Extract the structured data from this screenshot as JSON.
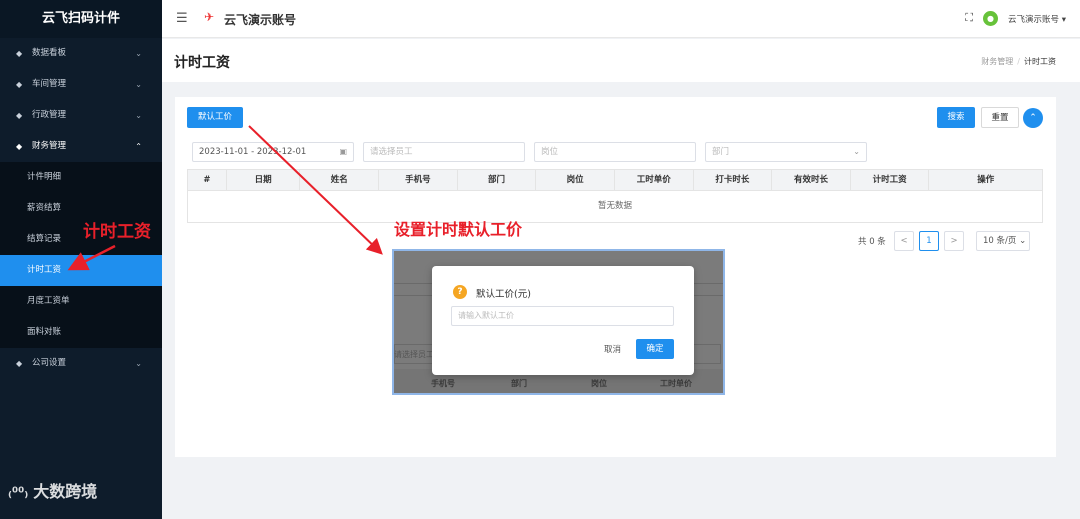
{
  "sidebar": {
    "logo": "云飞扫码计件",
    "menu": [
      {
        "label": "数据看板"
      },
      {
        "label": "车间管理"
      },
      {
        "label": "行政管理"
      },
      {
        "label": "财务管理"
      }
    ],
    "finance_sub": [
      {
        "label": "计件明细"
      },
      {
        "label": "薪资结算"
      },
      {
        "label": "结算记录"
      },
      {
        "label": "计时工资"
      },
      {
        "label": "月度工资单"
      },
      {
        "label": "面料对账"
      }
    ],
    "bottom_menu": {
      "label": "公司设置"
    },
    "watermark": "大数跨境"
  },
  "header": {
    "brand": "云飞演示账号",
    "user": "云飞演示账号"
  },
  "titlebar": {
    "title": "计时工资",
    "breadcrumb_parent": "财务管理",
    "breadcrumb_current": "计时工资"
  },
  "toolbar": {
    "default_wage_button": "默认工价",
    "search_button": "搜索",
    "reset_button": "重置"
  },
  "filters": {
    "date_range": "2023-11-01 - 2023-12-01",
    "employee_placeholder": "请选择员工",
    "post_placeholder": "岗位",
    "dept_placeholder": "部门"
  },
  "table": {
    "columns": [
      "#",
      "日期",
      "姓名",
      "手机号",
      "部门",
      "岗位",
      "工时单价",
      "打卡时长",
      "有效时长",
      "计时工资",
      "操作"
    ],
    "empty_text": "暂无数据"
  },
  "pagination": {
    "total": "共 0 条",
    "prev": "<",
    "page": "1",
    "next": ">",
    "page_size": "10 条/页"
  },
  "annotations": {
    "sidebar_callout": "计时工资",
    "main_callout": "设置计时默认工价"
  },
  "inset": {
    "partial_placeholder": "请选择员工",
    "columns": [
      "手机号",
      "部门",
      "岗位",
      "工时单价"
    ]
  },
  "modal": {
    "title": "默认工价(元)",
    "placeholder": "请输入默认工价",
    "cancel": "取消",
    "confirm": "确定"
  },
  "colors": {
    "primary": "#1f8fee",
    "sidebar_bg": "#0e1c2b",
    "annotation_red": "#e8202a",
    "warning": "#f5a623",
    "avatar": "#67c23a"
  }
}
